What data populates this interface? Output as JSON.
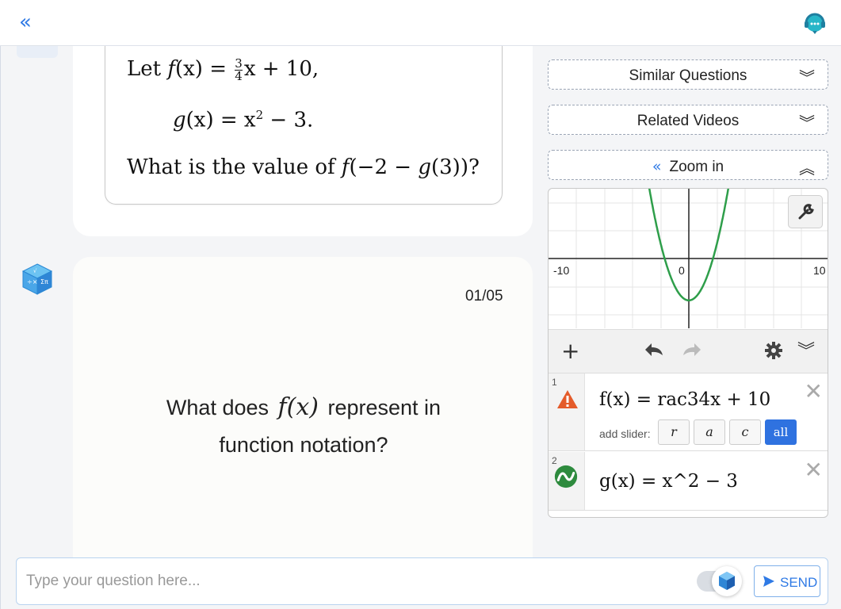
{
  "topbar": {
    "collapse_icon": "double-chevron-left-icon",
    "support_icon": "chat-support-icon"
  },
  "question": {
    "line1_prefix": "Let ",
    "line1_func": "f",
    "line1_mid": "(x) = ",
    "line1_frac_num": "3",
    "line1_frac_den": "4",
    "line1_suffix": "x + 10,",
    "line2_func": "g",
    "line2_mid": "(x) = x",
    "line2_exp": "2",
    "line2_suffix": " − 3.",
    "line3_prefix": "What is the value of ",
    "line3_func": "f",
    "line3_mid": "(−2 − ",
    "line3_func2": "g",
    "line3_suffix": "(3))?"
  },
  "flashcard": {
    "counter": "01/05",
    "text_before": "What does",
    "math": "f(x)",
    "text_after": "represent in function notation?"
  },
  "sidebar": {
    "similar_label": "Similar Questions",
    "related_label": "Related Videos",
    "zoom_label": "Zoom in",
    "zoom_lead_icon": "double-chevron-left-icon",
    "chev_down_icon": "double-chevron-down-icon",
    "chev_up_icon": "double-chevron-up-icon"
  },
  "calculator": {
    "axis_left": "-10",
    "axis_origin": "0",
    "axis_right": "10",
    "curve_color": "#2e9e4a",
    "add_icon": "+",
    "undo_icon": "undo-icon",
    "redo_icon": "redo-icon",
    "settings_icon": "gear-icon",
    "collapse_icon": "double-chevron-down-icon",
    "expressions": [
      {
        "num": "1",
        "icon": "warning-icon",
        "latex": "f(x) = rac34x + 10"
      },
      {
        "num": "2",
        "icon": "graph-wave-icon",
        "latex": "g(x) = x^2 − 3"
      }
    ],
    "slider_label": "add slider:",
    "slider_buttons": [
      "r",
      "a",
      "c",
      "all"
    ],
    "close_glyph": "✕"
  },
  "input_bar": {
    "placeholder": "Type your question here...",
    "value": "",
    "send_label": "SEND",
    "accent": "#2f7ae5"
  }
}
